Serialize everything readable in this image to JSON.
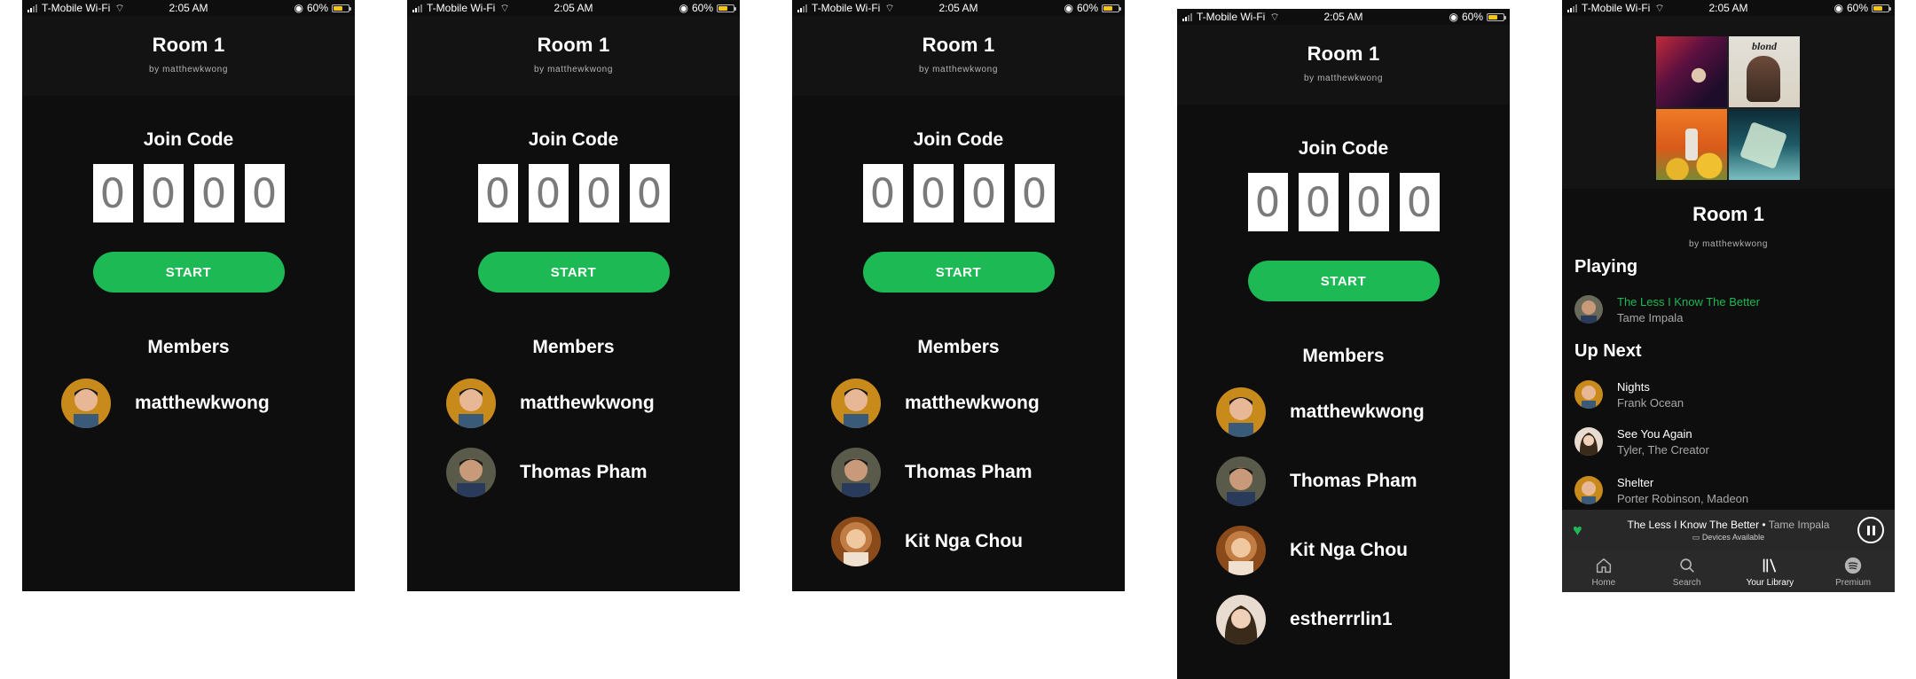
{
  "status": {
    "carrier": "T-Mobile Wi-Fi",
    "time": "2:05 AM",
    "battery": "60%"
  },
  "room": {
    "title": "Room 1",
    "by": "by matthewkwong"
  },
  "join": {
    "label": "Join Code",
    "digits": [
      "0",
      "0",
      "0",
      "0"
    ],
    "start_label": "START",
    "members_label": "Members"
  },
  "members": [
    {
      "name": "matthewkwong"
    },
    {
      "name": "Thomas Pham"
    },
    {
      "name": "Kit Nga Chou"
    },
    {
      "name": "estherrrlin1"
    }
  ],
  "player": {
    "playing_label": "Playing",
    "up_next_label": "Up Next",
    "now_playing": {
      "title": "The Less I Know The Better",
      "artist": "Tame Impala"
    },
    "up_next": [
      {
        "title": "Nights",
        "artist": "Frank Ocean"
      },
      {
        "title": "See You Again",
        "artist": "Tyler, The Creator"
      },
      {
        "title": "Shelter",
        "artist": "Porter Robinson, Madeon"
      }
    ],
    "mini": {
      "song": "The Less I Know The Better",
      "separator": " • ",
      "artist": "Tame Impala",
      "devices": "Devices Available"
    },
    "album_text": "blond"
  },
  "tabs": [
    {
      "label": "Home",
      "icon": "home-icon"
    },
    {
      "label": "Search",
      "icon": "search-icon"
    },
    {
      "label": "Your Library",
      "icon": "library-icon"
    },
    {
      "label": "Premium",
      "icon": "spotify-icon"
    }
  ],
  "colors": {
    "accent": "#1db954",
    "background": "#0e0e0e",
    "header": "#131313"
  }
}
